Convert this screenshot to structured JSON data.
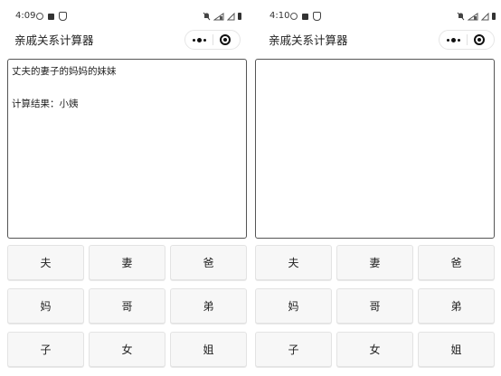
{
  "panels": [
    {
      "status": {
        "time": "4:09"
      },
      "app_title": "亲戚关系计算器",
      "input_text": "丈夫的妻子的妈妈的妹妹",
      "result_text": "计算结果：小姨",
      "keys": [
        "夫",
        "妻",
        "爸",
        "妈",
        "哥",
        "弟",
        "子",
        "女",
        "姐"
      ]
    },
    {
      "status": {
        "time": "4:10"
      },
      "app_title": "亲戚关系计算器",
      "input_text": "",
      "result_text": "",
      "keys": [
        "夫",
        "妻",
        "爸",
        "妈",
        "哥",
        "弟",
        "子",
        "女",
        "姐"
      ]
    }
  ],
  "icons": {
    "status_left": [
      "search-icon",
      "image-icon",
      "shield-icon"
    ],
    "status_right": [
      "bell-off-icon",
      "signal-icon",
      "triangle-icon",
      "battery-icon"
    ],
    "capsule": [
      "more-icon",
      "close-target-icon"
    ]
  },
  "colors": {
    "background": "#ffffff",
    "key_background": "#f7f7f7",
    "key_border": "#e3e3e3",
    "textarea_border": "#555555"
  }
}
